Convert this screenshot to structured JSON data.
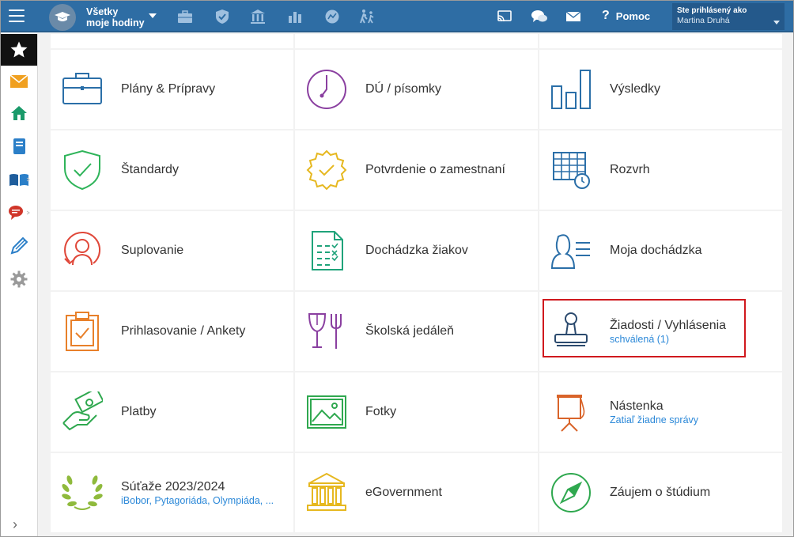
{
  "header": {
    "class_label_line1": "Všetky",
    "class_label_line2": "moje hodiny",
    "help_label": "Pomoc",
    "logged_in_label": "Ste prihlásený ako",
    "user_name": "Martina Druhá"
  },
  "tiles": [
    {
      "title": "Plány & Prípravy",
      "subtitle": "",
      "icon": "briefcase-icon",
      "color": "#2b6fa8"
    },
    {
      "title": "DÚ / písomky",
      "subtitle": "",
      "icon": "clock-icon",
      "color": "#8a3fa0"
    },
    {
      "title": "Výsledky",
      "subtitle": "",
      "icon": "bar-chart-icon",
      "color": "#2b6fa8"
    },
    {
      "title": "Štandardy",
      "subtitle": "",
      "icon": "shield-check-icon",
      "color": "#2fb45a"
    },
    {
      "title": "Potvrdenie o zamestnaní",
      "subtitle": "",
      "icon": "certificate-seal-icon",
      "color": "#e6b820"
    },
    {
      "title": "Rozvrh",
      "subtitle": "",
      "icon": "timetable-icon",
      "color": "#2b6fa8"
    },
    {
      "title": "Suplovanie",
      "subtitle": "",
      "icon": "substitute-person-icon",
      "color": "#e0483a"
    },
    {
      "title": "Dochádzka žiakov",
      "subtitle": "",
      "icon": "attendance-sheet-icon",
      "color": "#1fa37a"
    },
    {
      "title": "Moja dochádzka",
      "subtitle": "",
      "icon": "person-list-icon",
      "color": "#2b6fa8"
    },
    {
      "title": "Prihlasovanie / Ankety",
      "subtitle": "",
      "icon": "clipboard-check-icon",
      "color": "#e8802a"
    },
    {
      "title": "Školská jedáleň",
      "subtitle": "",
      "icon": "cutlery-icon",
      "color": "#8a3fa0"
    },
    {
      "title": "Žiadosti / Vyhlásenia",
      "subtitle": "schválená (1)",
      "icon": "stamp-icon",
      "color": "#2b4a6e"
    },
    {
      "title": "Platby",
      "subtitle": "",
      "icon": "payment-hand-icon",
      "color": "#2fa84f"
    },
    {
      "title": "Fotky",
      "subtitle": "",
      "icon": "photo-icon",
      "color": "#2fa84f"
    },
    {
      "title": "Nástenka",
      "subtitle": "Zatiaľ žiadne správy",
      "icon": "flipchart-icon",
      "color": "#d9642a"
    },
    {
      "title": "Súťaže 2023/2024",
      "subtitle": "iBobor, Pytagoriáda, Olympiáda, ...",
      "icon": "laurel-wreath-icon",
      "color": "#8fba3c"
    },
    {
      "title": "eGovernment",
      "subtitle": "",
      "icon": "government-building-icon",
      "color": "#e6b820"
    },
    {
      "title": "Záujem o štúdium",
      "subtitle": "",
      "icon": "compass-icon",
      "color": "#2fa84f"
    }
  ],
  "colors": {
    "topbar": "#2e6da4",
    "highlight": "#d0191e",
    "link": "#2b88d8"
  }
}
